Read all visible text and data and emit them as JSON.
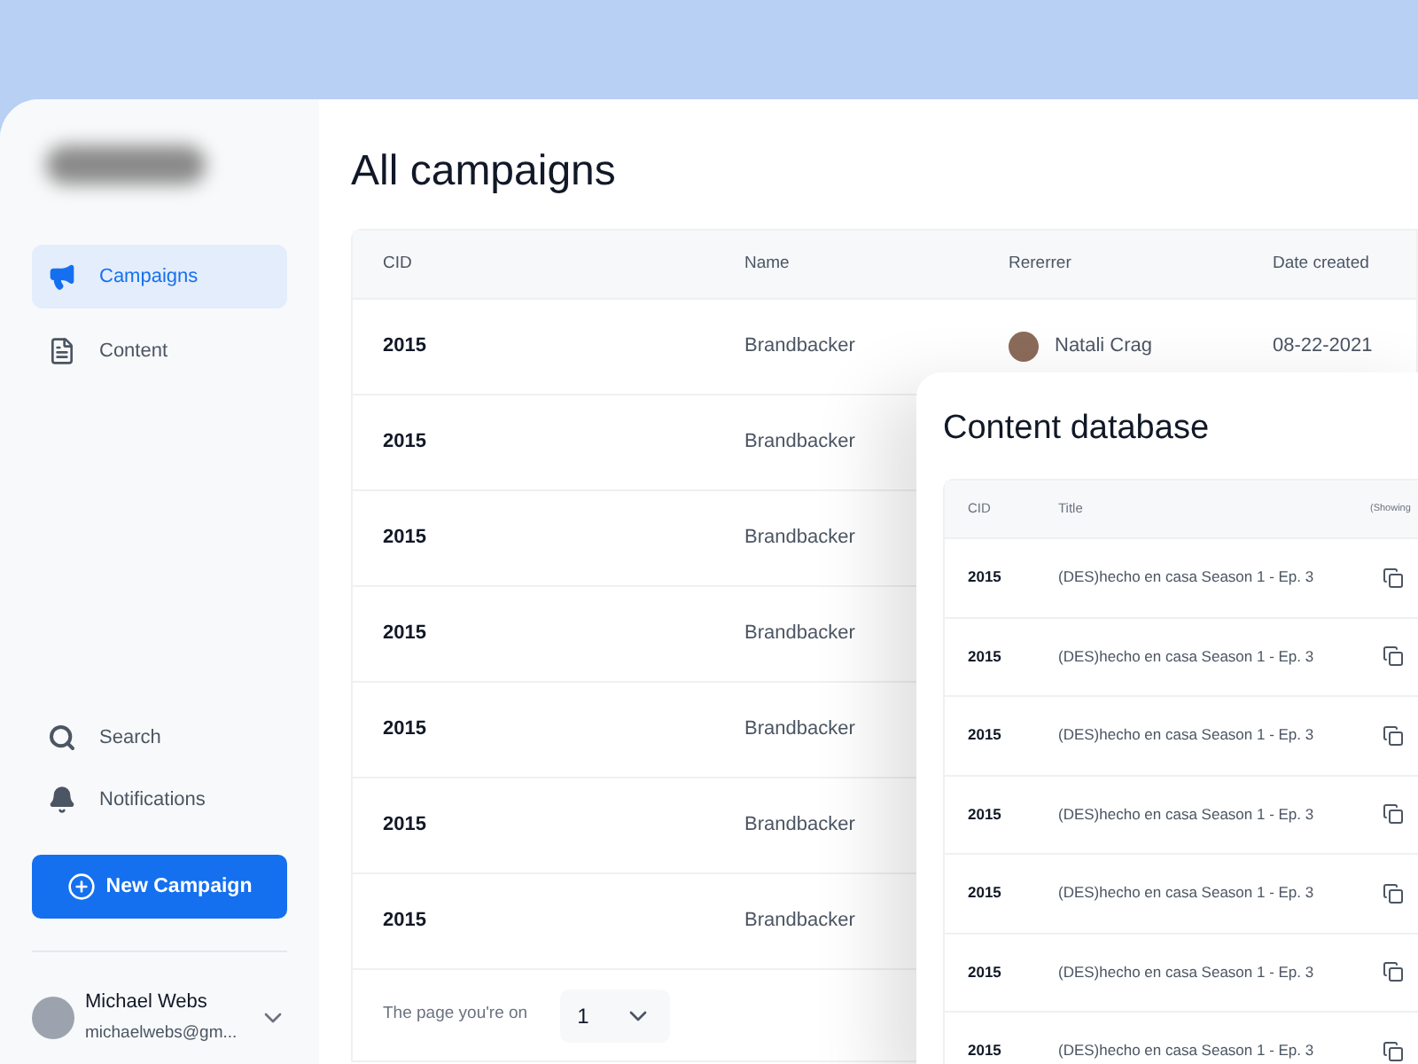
{
  "sidebar": {
    "nav_items": [
      {
        "label": "Campaigns",
        "kind": "megaphone",
        "selected": true
      },
      {
        "label": "Content",
        "kind": "document",
        "selected": false
      }
    ],
    "bottom_items": [
      {
        "label": "Search",
        "kind": "search"
      },
      {
        "label": "Notifications",
        "kind": "bell"
      }
    ],
    "new_button": "New Campaign",
    "user": {
      "name": "Michael Webs",
      "email": "michaelwebs@gm..."
    }
  },
  "main": {
    "title": "All campaigns",
    "table": {
      "columns": [
        "CID",
        "Name",
        "Rererrer",
        "Date created"
      ],
      "rows": [
        {
          "cid": "2015",
          "name": "Brandbacker",
          "referrer": "Natali Crag",
          "date": "08-22-2021"
        },
        {
          "cid": "2015",
          "name": "Brandbacker"
        },
        {
          "cid": "2015",
          "name": "Brandbacker"
        },
        {
          "cid": "2015",
          "name": "Brandbacker"
        },
        {
          "cid": "2015",
          "name": "Brandbacker"
        },
        {
          "cid": "2015",
          "name": "Brandbacker"
        },
        {
          "cid": "2015",
          "name": "Brandbacker"
        }
      ]
    },
    "pagination": {
      "label": "The page you're on",
      "value": "1"
    }
  },
  "content_database": {
    "title": "Content database",
    "columns": [
      "CID",
      "Title",
      "(Showing"
    ],
    "rows": [
      {
        "cid": "2015",
        "title": "(DES)hecho en casa Season 1 - Ep. 3"
      },
      {
        "cid": "2015",
        "title": "(DES)hecho en casa Season 1 - Ep. 3"
      },
      {
        "cid": "2015",
        "title": "(DES)hecho en casa Season 1 - Ep. 3"
      },
      {
        "cid": "2015",
        "title": "(DES)hecho en casa Season 1 - Ep. 3"
      },
      {
        "cid": "2015",
        "title": "(DES)hecho en casa Season 1 - Ep. 3"
      },
      {
        "cid": "2015",
        "title": "(DES)hecho en casa Season 1 - Ep. 3"
      },
      {
        "cid": "2015",
        "title": "(DES)hecho en casa Season 1 - Ep. 3"
      }
    ]
  }
}
